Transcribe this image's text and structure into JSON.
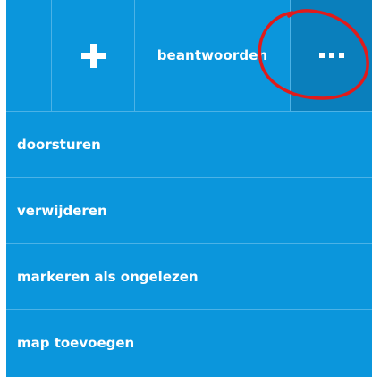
{
  "toolbar": {
    "add_icon": "plus-icon",
    "reply_label": "beantwoorden",
    "more_icon": "ellipsis-icon"
  },
  "menu": {
    "items": [
      {
        "label": "doorsturen"
      },
      {
        "label": "verwijderen"
      },
      {
        "label": "markeren als ongelezen"
      },
      {
        "label": "map toevoegen"
      }
    ]
  },
  "colors": {
    "panel": "#0b96dc",
    "more_active": "#0a7fbc",
    "divider": "#4cb2e6",
    "annotation": "#e01b1b"
  }
}
